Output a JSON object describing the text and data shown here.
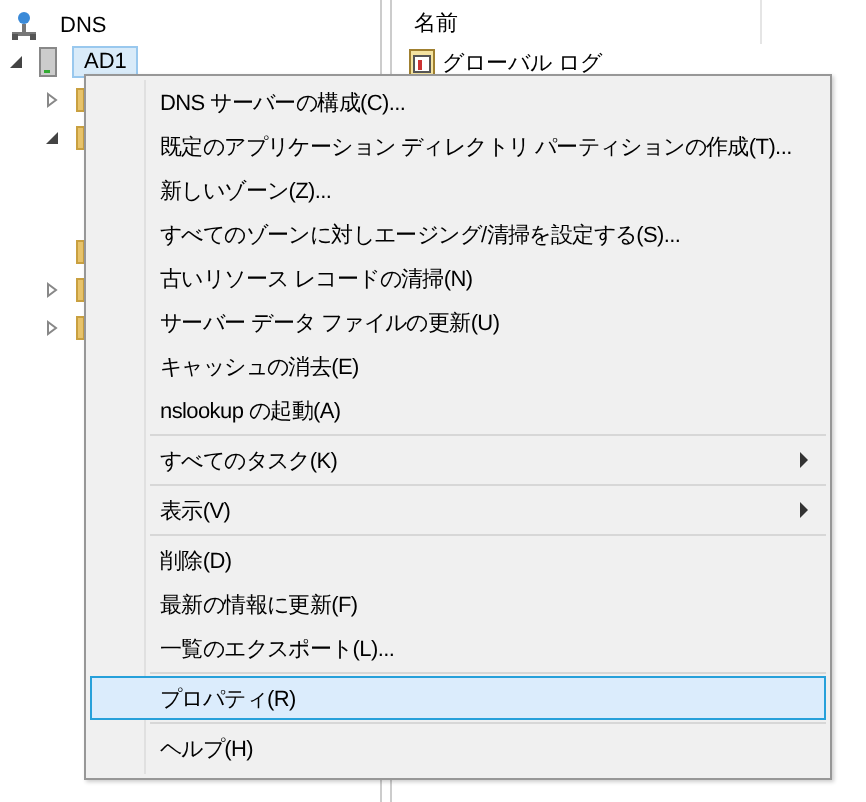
{
  "tree": {
    "label": "DNS",
    "children": [
      {
        "label": "AD1",
        "selected": true,
        "expanded": true,
        "children": [
          {
            "kind": "folder",
            "has_children": true,
            "expanded": false
          },
          {
            "kind": "folder",
            "has_children": true,
            "expanded": true
          },
          {
            "kind": "spacer"
          },
          {
            "kind": "spacer"
          },
          {
            "kind": "folder",
            "has_children": false
          },
          {
            "kind": "folder",
            "has_children": true,
            "expanded": false
          },
          {
            "kind": "folder",
            "has_children": true,
            "expanded": false
          }
        ]
      }
    ]
  },
  "list": {
    "columns": [
      {
        "label": "名前"
      }
    ],
    "rows": [
      {
        "name": "グローバル ログ"
      }
    ]
  },
  "context_menu": {
    "items": [
      {
        "kind": "item",
        "label": "DNS サーバーの構成(C)...",
        "submenu": false,
        "selected": false
      },
      {
        "kind": "item",
        "label": "既定のアプリケーション ディレクトリ パーティションの作成(T)...",
        "submenu": false,
        "selected": false
      },
      {
        "kind": "item",
        "label": "新しいゾーン(Z)...",
        "submenu": false,
        "selected": false
      },
      {
        "kind": "item",
        "label": "すべてのゾーンに対しエージング/清掃を設定する(S)...",
        "submenu": false,
        "selected": false
      },
      {
        "kind": "item",
        "label": "古いリソース レコードの清掃(N)",
        "submenu": false,
        "selected": false
      },
      {
        "kind": "item",
        "label": "サーバー データ ファイルの更新(U)",
        "submenu": false,
        "selected": false
      },
      {
        "kind": "item",
        "label": "キャッシュの消去(E)",
        "submenu": false,
        "selected": false
      },
      {
        "kind": "item",
        "label": "nslookup の起動(A)",
        "submenu": false,
        "selected": false
      },
      {
        "kind": "separator"
      },
      {
        "kind": "item",
        "label": "すべてのタスク(K)",
        "submenu": true,
        "selected": false
      },
      {
        "kind": "separator"
      },
      {
        "kind": "item",
        "label": "表示(V)",
        "submenu": true,
        "selected": false
      },
      {
        "kind": "separator"
      },
      {
        "kind": "item",
        "label": "削除(D)",
        "submenu": false,
        "selected": false
      },
      {
        "kind": "item",
        "label": "最新の情報に更新(F)",
        "submenu": false,
        "selected": false
      },
      {
        "kind": "item",
        "label": "一覧のエクスポート(L)...",
        "submenu": false,
        "selected": false
      },
      {
        "kind": "separator"
      },
      {
        "kind": "item",
        "label": "プロパティ(R)",
        "submenu": false,
        "selected": true
      },
      {
        "kind": "separator"
      },
      {
        "kind": "item",
        "label": "ヘルプ(H)",
        "submenu": false,
        "selected": false
      }
    ]
  }
}
